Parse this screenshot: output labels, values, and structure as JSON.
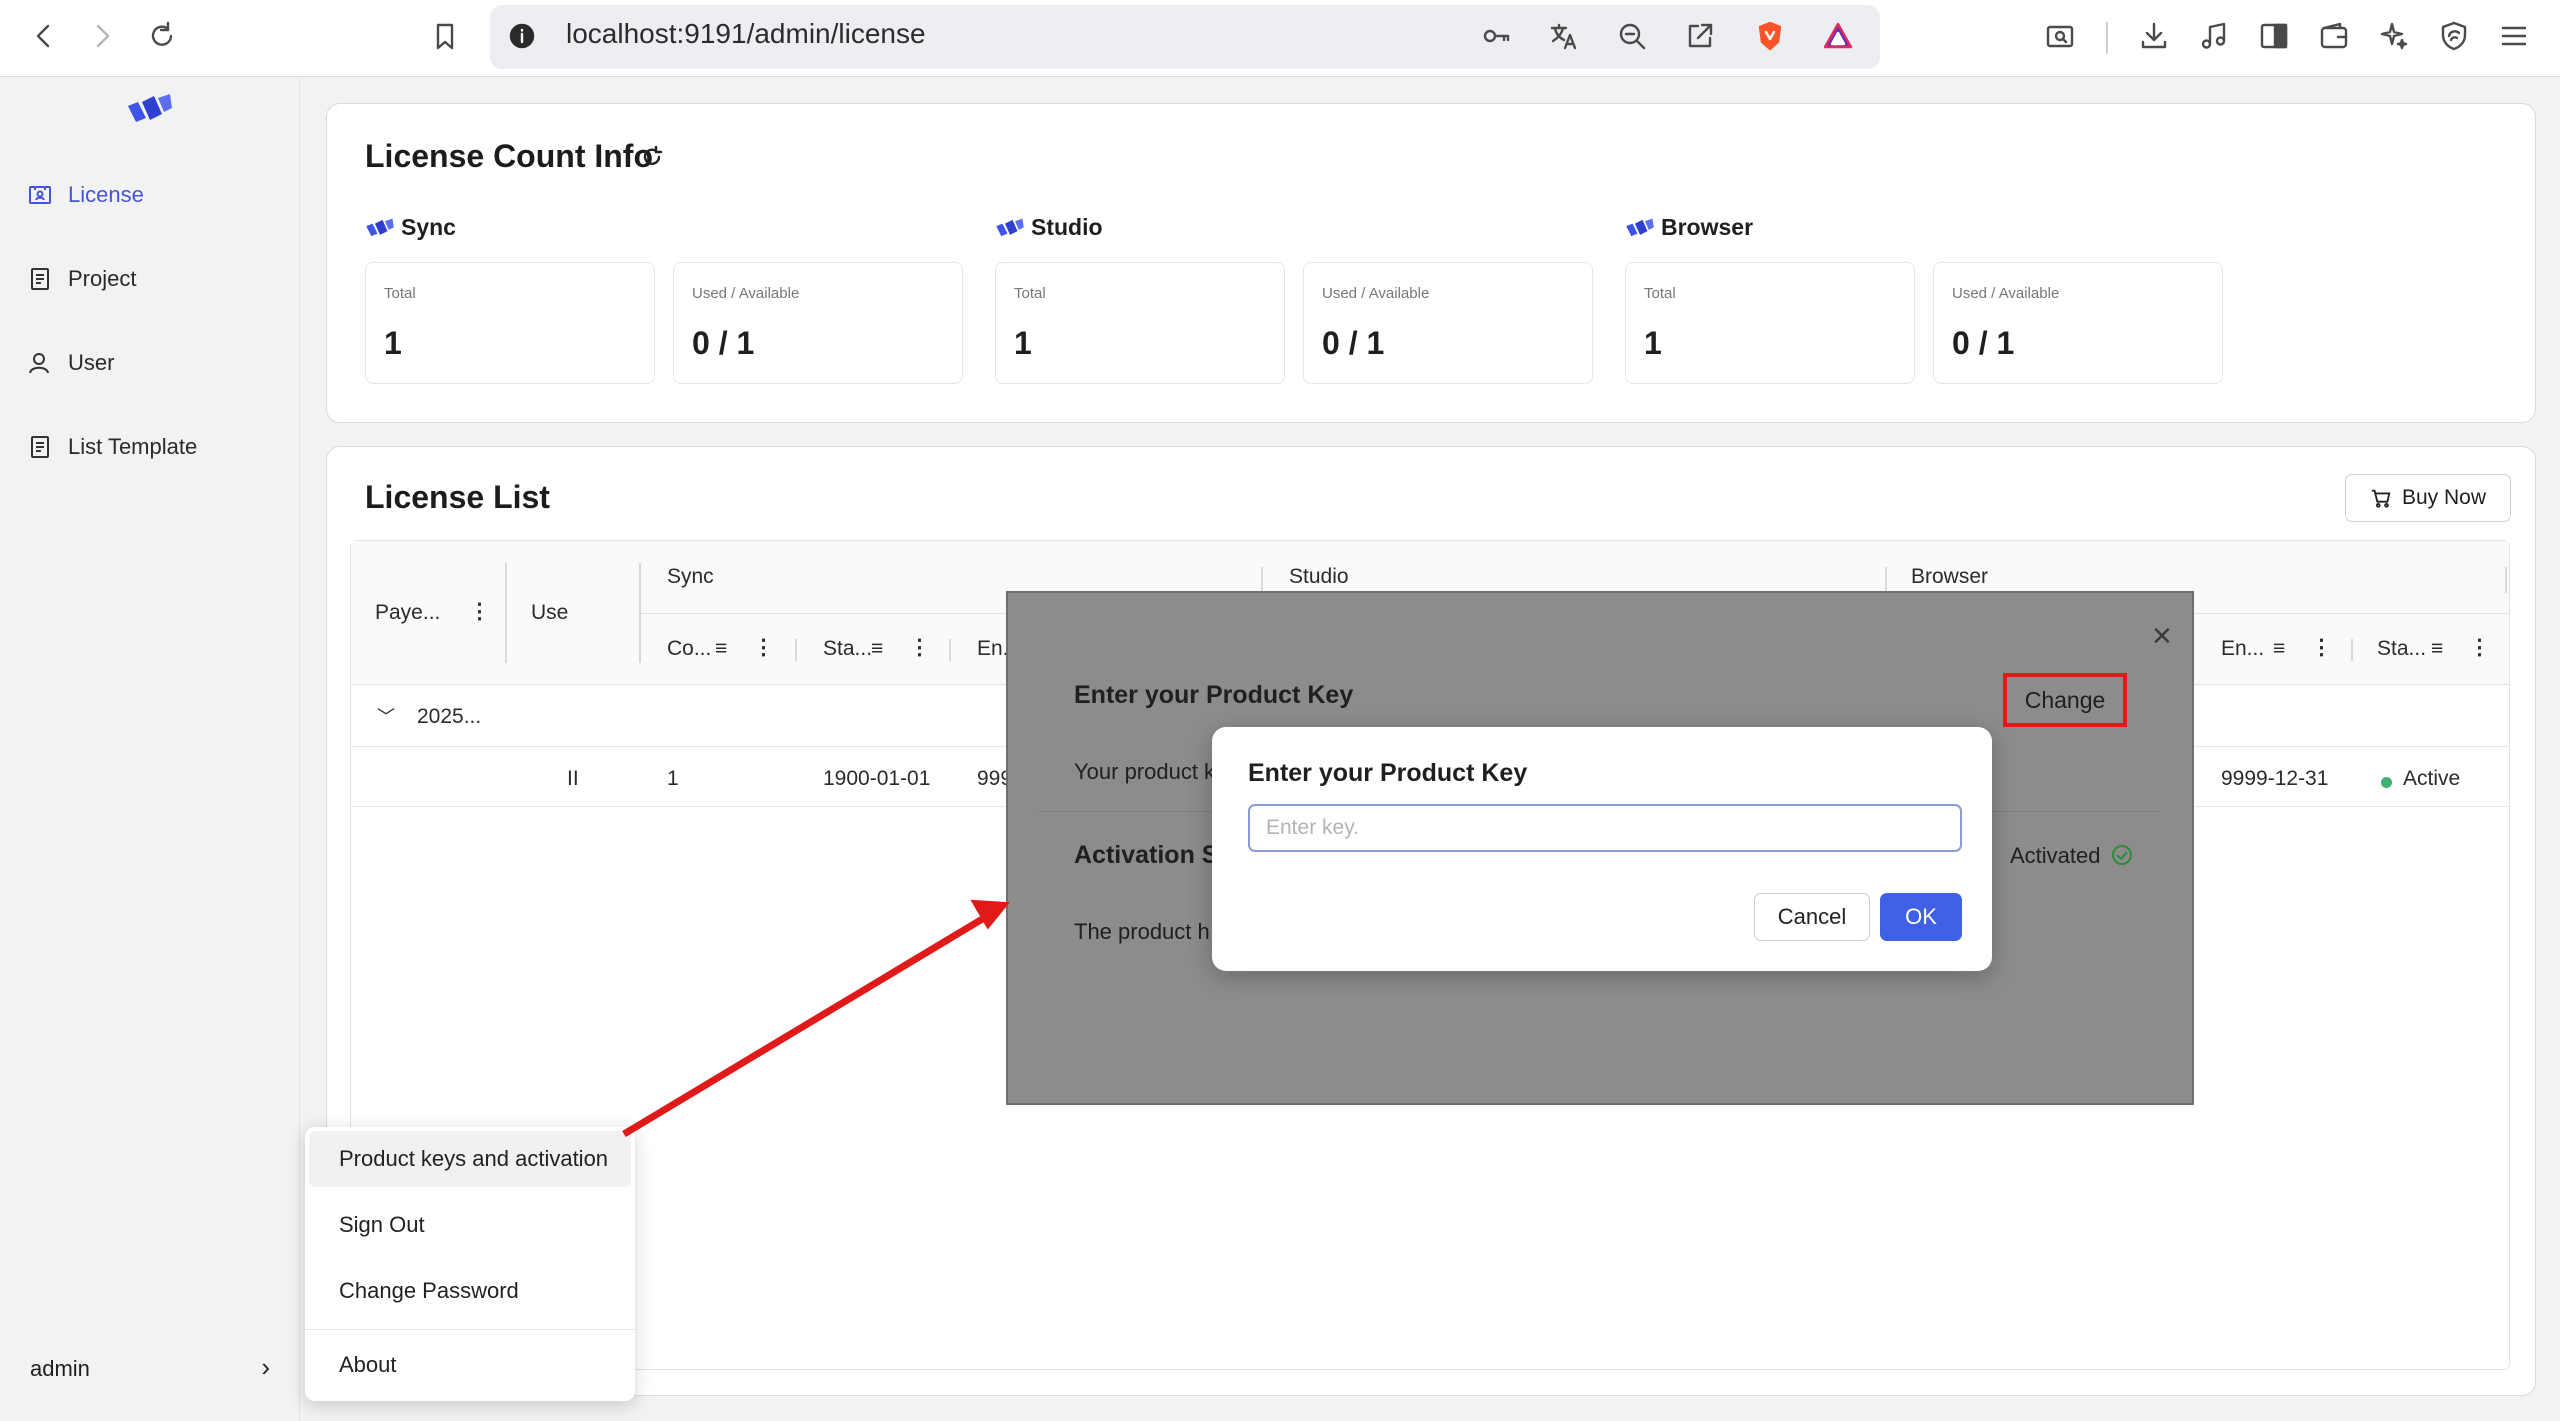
{
  "browser": {
    "url": "localhost:9191/admin/license",
    "icons": [
      "back-icon",
      "forward-icon",
      "reload-icon",
      "bookmark-icon",
      "info-icon",
      "key-icon",
      "translate-icon",
      "zoom-out-icon",
      "share-icon",
      "brave-shield-icon",
      "brave-rewards-icon",
      "screenshot-icon",
      "download-icon",
      "media-icon",
      "sidebar-icon",
      "wallet-icon",
      "leo-ai-icon",
      "vpn-icon",
      "menu-icon"
    ]
  },
  "sidebar": {
    "items": [
      {
        "label": "License",
        "icon": "license-icon",
        "active": true
      },
      {
        "label": "Project",
        "icon": "document-icon",
        "active": false
      },
      {
        "label": "User",
        "icon": "user-icon",
        "active": false
      },
      {
        "label": "List Template",
        "icon": "document-icon",
        "active": false
      }
    ],
    "user": {
      "name": "admin",
      "chevron": "›"
    }
  },
  "count_info": {
    "title": "License Count Info",
    "products": [
      {
        "name": "Sync",
        "total_label": "Total",
        "total": "1",
        "used_label": "Used / Available",
        "used": "0 / 1"
      },
      {
        "name": "Studio",
        "total_label": "Total",
        "total": "1",
        "used_label": "Used / Available",
        "used": "0 / 1"
      },
      {
        "name": "Browser",
        "total_label": "Total",
        "total": "1",
        "used_label": "Used / Available",
        "used": "0 / 1"
      }
    ]
  },
  "license_list": {
    "title": "License List",
    "buy_now": "Buy Now",
    "headers": {
      "payee": "Paye...",
      "use": "Use",
      "sync": "Sync",
      "studio": "Studio",
      "browser": "Browser",
      "sync_count": "Co...",
      "sync_start": "Sta...",
      "sync_end": "En..",
      "browser_end": "En...",
      "browser_status": "Sta..."
    },
    "group_label": "2025...",
    "row": {
      "use": "II",
      "count": "1",
      "start": "1900-01-01",
      "end_partial": "999",
      "browser_end": "9999-12-31",
      "status": "Active",
      "status_color": "#3cb371"
    }
  },
  "product_modal": {
    "enter_key_heading": "Enter your Product Key",
    "your_key_text": "Your product k",
    "change_button": "Change",
    "activation_heading": "Activation St",
    "activation_body": "The product h",
    "activated": "Activated",
    "close": "×"
  },
  "key_dialog": {
    "title": "Enter your Product Key",
    "placeholder": "Enter key.",
    "value": "",
    "cancel": "Cancel",
    "ok": "OK",
    "accent": "#4060e6"
  },
  "user_menu": {
    "items": [
      "Product keys and activation",
      "Sign Out",
      "Change Password",
      "About"
    ]
  },
  "annotation": {
    "arrow_color": "#e01919",
    "highlight_color": "#e01919"
  }
}
